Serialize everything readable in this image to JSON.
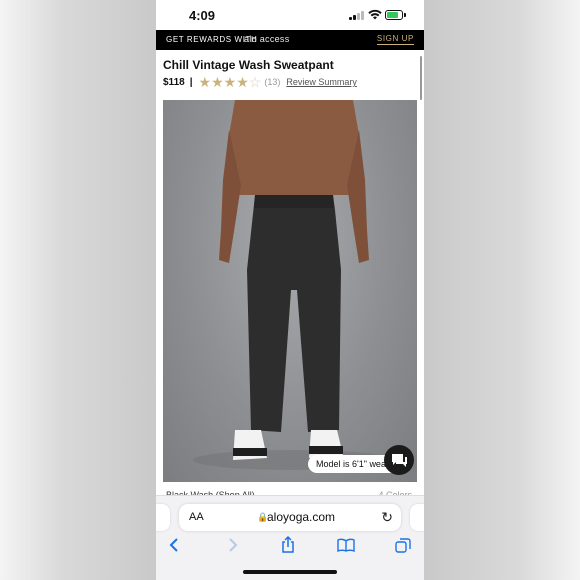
{
  "status_bar": {
    "time": "4:09"
  },
  "promo": {
    "text": "GET REWARDS WITH",
    "logo": "alo access",
    "cta": "SIGN UP"
  },
  "product": {
    "title": "Chill Vintage Wash Sweatpant",
    "price": "$118",
    "separator": "|",
    "rating": 4,
    "rating_max": 5,
    "review_count": "(13)",
    "review_link": "Review Summary",
    "model_info": "Model is 6'1\" wear...",
    "variant_label": "Black Wash (Shop All)",
    "colors_count": "4 Colors"
  },
  "browser": {
    "text_size_button": "AA",
    "url": "aloyoga.com"
  },
  "icons": {
    "back": "chevron-left-icon",
    "forward": "chevron-right-icon",
    "share": "share-icon",
    "bookmarks": "book-icon",
    "tabs": "tabs-icon",
    "chat": "chat-icon",
    "reload": "reload-icon",
    "lock": "lock-icon"
  },
  "colors": {
    "accent_gold": "#c9b27c",
    "ios_blue": "#1a73e8",
    "battery_green": "#34c759"
  }
}
